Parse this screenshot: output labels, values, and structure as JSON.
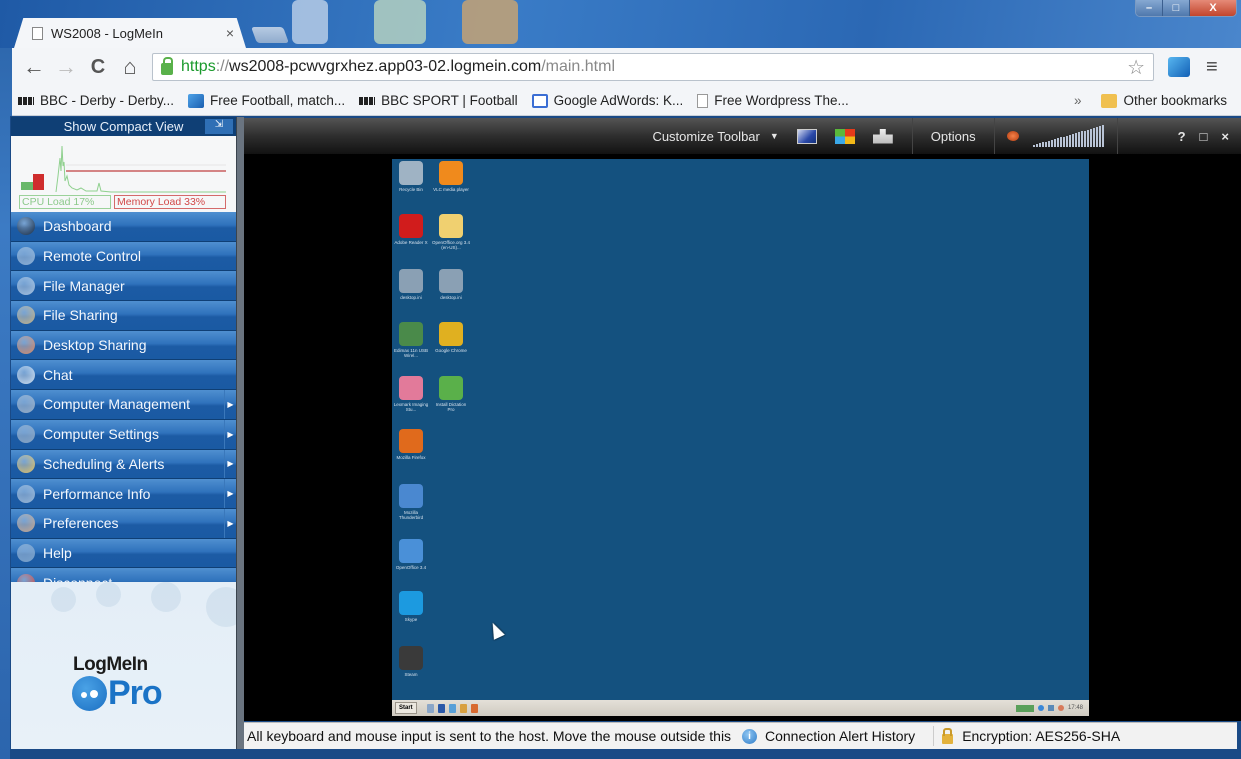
{
  "os": {
    "window_controls": {
      "minimize": "–",
      "maximize": "□",
      "close": "X"
    }
  },
  "browser": {
    "tab": {
      "title": "WS2008 - LogMeIn",
      "close": "×",
      "icon": "document-icon"
    },
    "nav": {
      "back": "←",
      "forward": "→",
      "reload": "C",
      "home": "⌂"
    },
    "url": {
      "scheme": "https",
      "separator": "://",
      "host": "ws2008-pcwvgrxhez.app03-02.logmein.com",
      "path": "/main.html"
    },
    "star": "☆",
    "menu": "≡",
    "bookmarks": [
      {
        "label": "BBC - Derby - Derby...",
        "icon": "bbc-icon"
      },
      {
        "label": "Free Football, match...",
        "icon": "football-icon"
      },
      {
        "label": "BBC SPORT | Football",
        "icon": "bbc-icon"
      },
      {
        "label": "Google AdWords: K...",
        "icon": "google-icon"
      },
      {
        "label": "Free Wordpress The...",
        "icon": "document-icon"
      }
    ],
    "bookmarks_more": "»",
    "other_bookmarks": "Other bookmarks"
  },
  "sidebar": {
    "compact_view": "Show Compact View",
    "perf": {
      "cpu_label": "CPU Load 17%",
      "memory_label": "Memory Load 33%",
      "cpu_percent": 17,
      "memory_percent": 33
    },
    "items": [
      {
        "label": "Dashboard",
        "icon": "dashboard-icon",
        "color": "#1c2e45",
        "submenu": false
      },
      {
        "label": "Remote Control",
        "icon": "remote-control-icon",
        "color": "#8fb3d8",
        "submenu": false
      },
      {
        "label": "File Manager",
        "icon": "file-manager-icon",
        "color": "#a8c4e2",
        "submenu": false
      },
      {
        "label": "File Sharing",
        "icon": "file-sharing-icon",
        "color": "#c7b58a",
        "submenu": false
      },
      {
        "label": "Desktop Sharing",
        "icon": "desktop-sharing-icon",
        "color": "#d98c6a",
        "submenu": false
      },
      {
        "label": "Chat",
        "icon": "chat-icon",
        "color": "#d2e2f2",
        "submenu": false
      },
      {
        "label": "Computer Management",
        "icon": "computer-management-icon",
        "color": "#9ab0c8",
        "submenu": true
      },
      {
        "label": "Computer Settings",
        "icon": "computer-settings-icon",
        "color": "#8aa6c4",
        "submenu": true
      },
      {
        "label": "Scheduling & Alerts",
        "icon": "scheduling-icon",
        "color": "#e2c46a",
        "submenu": true
      },
      {
        "label": "Performance Info",
        "icon": "performance-icon",
        "color": "#9ab8d8",
        "submenu": true
      },
      {
        "label": "Preferences",
        "icon": "preferences-icon",
        "color": "#c8a890",
        "submenu": true
      },
      {
        "label": "Help",
        "icon": "help-icon",
        "color": "#7aa2cc",
        "submenu": false
      },
      {
        "label": "Disconnect",
        "icon": "disconnect-icon",
        "color": "#d8463a",
        "submenu": false
      }
    ],
    "submenu_arrow": "▶",
    "logo": {
      "top": "LogMeIn",
      "bottom": "Pro"
    }
  },
  "remote_toolbar": {
    "customize": "Customize Toolbar",
    "dropdown": "▼",
    "options": "Options",
    "help": "?",
    "restore": "□",
    "close": "×"
  },
  "remote_desktop": {
    "icons": [
      {
        "label": "Recycle Bin",
        "color": "#9fb3c4",
        "col": 0,
        "row": 0
      },
      {
        "label": "VLC media player",
        "color": "#f08a1c",
        "col": 1,
        "row": 0
      },
      {
        "label": "Adobe Reader X",
        "color": "#d11c1c",
        "col": 0,
        "row": 1
      },
      {
        "label": "OpenOffice.org 3.4 (en-US)...",
        "color": "#f0d070",
        "col": 1,
        "row": 1
      },
      {
        "label": "desktop.ini",
        "color": "#8aa0b4",
        "col": 0,
        "row": 2
      },
      {
        "label": "desktop.ini",
        "color": "#8aa0b4",
        "col": 1,
        "row": 2
      },
      {
        "label": "Edimax 11n USB Wirel...",
        "color": "#4a8a4a",
        "col": 0,
        "row": 3
      },
      {
        "label": "Google Chrome",
        "color": "#e0b020",
        "col": 1,
        "row": 3
      },
      {
        "label": "Lexmark Imaging Stu...",
        "color": "#e27a9a",
        "col": 0,
        "row": 4
      },
      {
        "label": "Install Dictation Pro",
        "color": "#5ab04a",
        "col": 1,
        "row": 4
      },
      {
        "label": "Mozilla Firefox",
        "color": "#e06a1c",
        "col": 0,
        "row": 5
      },
      {
        "label": "Mozilla Thunderbird",
        "color": "#4a88d0",
        "col": 0,
        "row": 6
      },
      {
        "label": "OpenOffice 3.4",
        "color": "#4a90d8",
        "col": 0,
        "row": 7
      },
      {
        "label": "Skype",
        "color": "#1c9ae0",
        "col": 0,
        "row": 8
      },
      {
        "label": "Steam",
        "color": "#3a3a3a",
        "col": 0,
        "row": 9
      }
    ],
    "taskbar": {
      "start": "Start",
      "clock": "17:48"
    }
  },
  "statusbar": {
    "message": "All keyboard and mouse input is sent to the host. Move the mouse outside this",
    "alert_history": "Connection Alert History",
    "encryption": "Encryption: AES256-SHA"
  }
}
